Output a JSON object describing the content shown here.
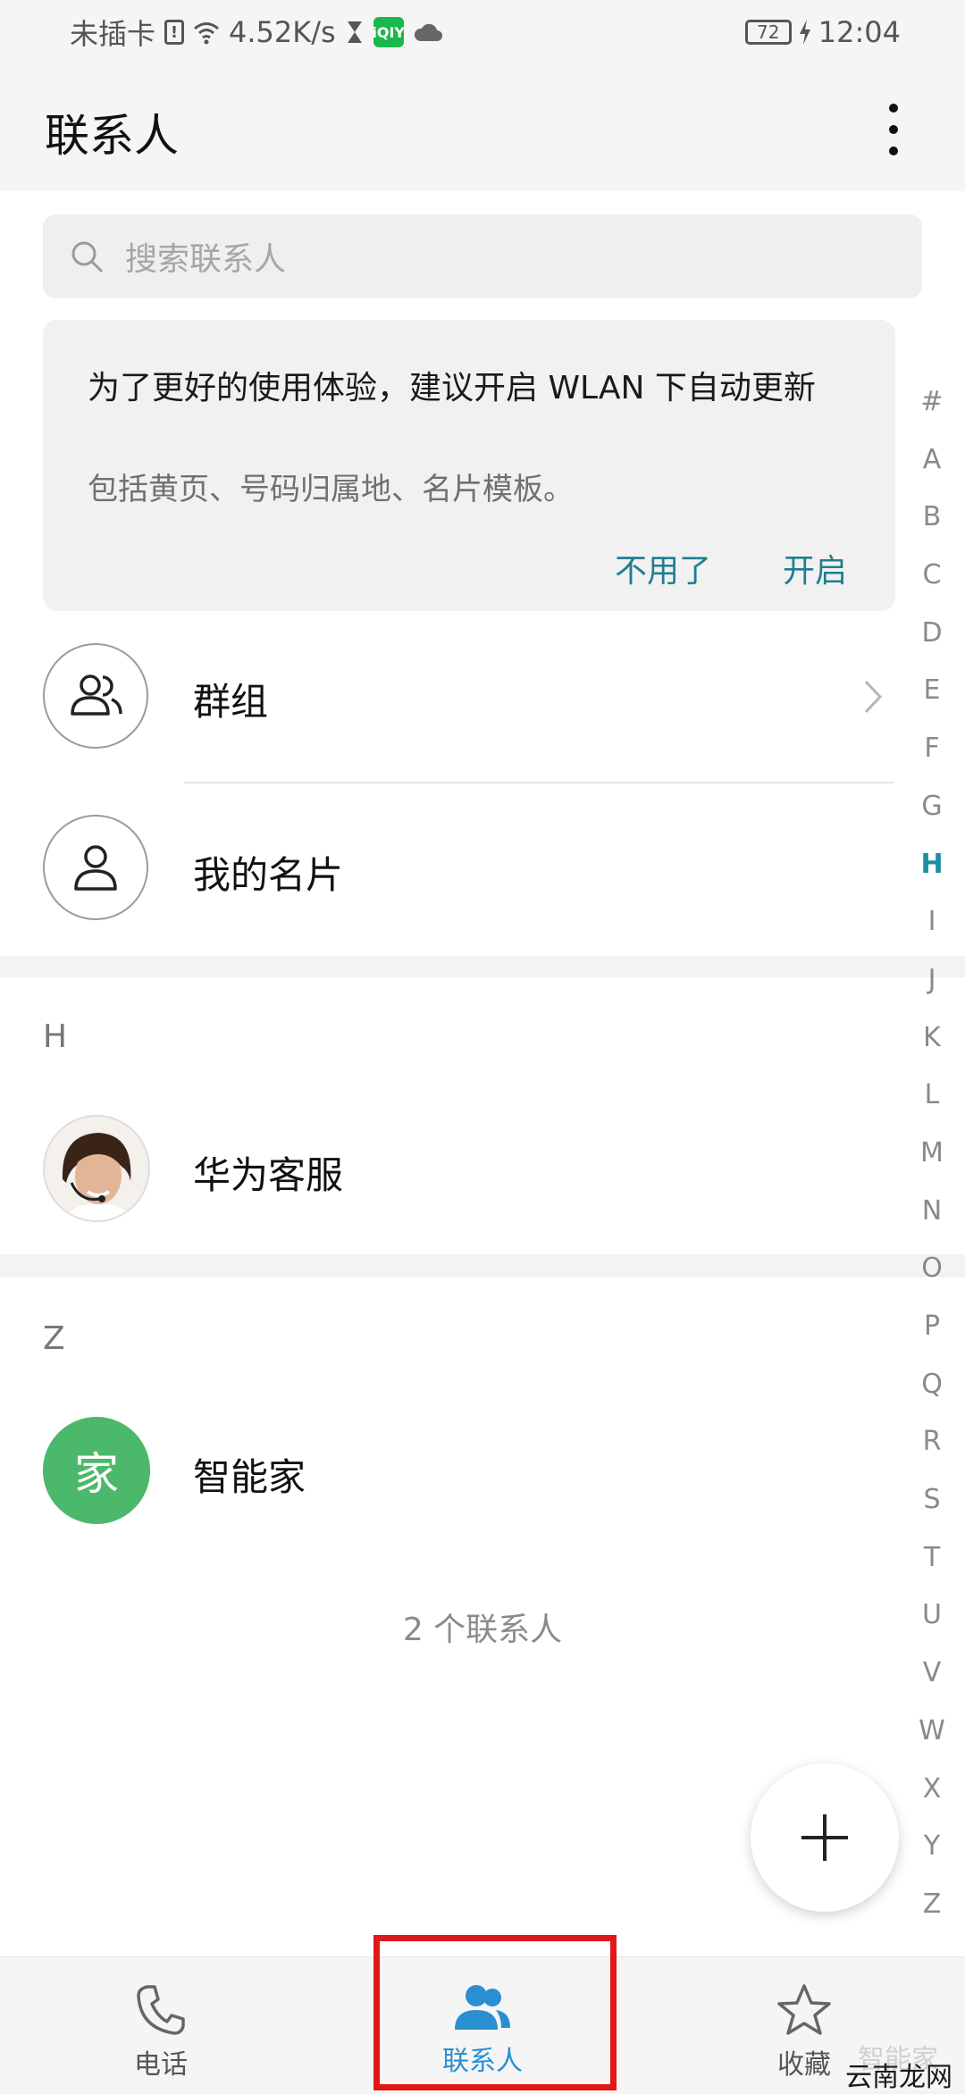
{
  "status_bar": {
    "carrier": "未插卡",
    "speed": "4.52K/s",
    "battery": "72",
    "time": "12:04",
    "iqiyi": "iQIY"
  },
  "header": {
    "title": "联系人"
  },
  "search": {
    "placeholder": "搜索联系人"
  },
  "banner": {
    "title": "为了更好的使用体验，建议开启 WLAN 下自动更新",
    "subtitle": "包括黄页、号码归属地、名片模板。",
    "dismiss_label": "不用了",
    "enable_label": "开启"
  },
  "rows": {
    "groups": "群组",
    "my_card": "我的名片"
  },
  "sections": [
    {
      "letter": "H",
      "contact": "华为客服"
    },
    {
      "letter": "Z",
      "contact": "智能家",
      "avatar_char": "家"
    }
  ],
  "contact_count": "2 个联系人",
  "index": [
    "#",
    "A",
    "B",
    "C",
    "D",
    "E",
    "F",
    "G",
    "H",
    "I",
    "J",
    "K",
    "L",
    "M",
    "N",
    "O",
    "P",
    "Q",
    "R",
    "S",
    "T",
    "U",
    "V",
    "W",
    "X",
    "Y",
    "Z"
  ],
  "index_active": "H",
  "nav": {
    "phone": "电话",
    "contacts": "联系人",
    "favorites": "收藏"
  },
  "watermark": "智能家",
  "watermark_site": "云南龙网",
  "colors": {
    "accent": "#1d8fa4",
    "nav_active": "#2a8fd0",
    "avatar_green": "#4cb86b",
    "highlight": "#e01818"
  }
}
